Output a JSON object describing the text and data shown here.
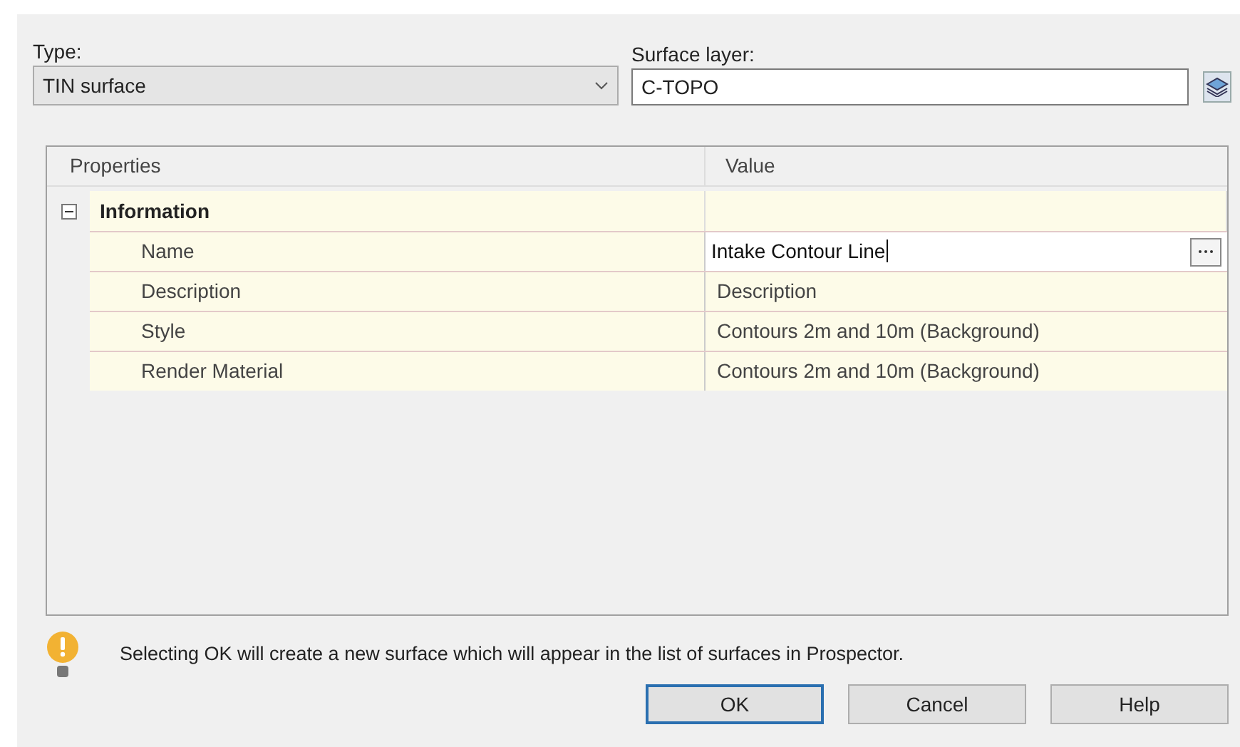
{
  "type_field": {
    "label": "Type:",
    "value": "TIN surface"
  },
  "surface_layer": {
    "label": "Surface layer:",
    "value": "C-TOPO"
  },
  "properties": {
    "columns": [
      "Properties",
      "Value"
    ],
    "category": {
      "label": "Information",
      "expanded": true,
      "children": [
        {
          "name": "Name",
          "value": "Intake Contour Line",
          "editing": true
        },
        {
          "name": "Description",
          "value": "Description",
          "editing": false
        },
        {
          "name": "Style",
          "value": "Contours 2m and 10m (Background)",
          "editing": false
        },
        {
          "name": "Render Material",
          "value": "Contours 2m and 10m (Background)",
          "editing": false
        }
      ]
    }
  },
  "message": "Selecting OK will create a new surface which will appear in the list of surfaces in Prospector.",
  "buttons": [
    {
      "label": "OK",
      "selected": true
    },
    {
      "label": "Cancel",
      "selected": false
    },
    {
      "label": "Help",
      "selected": false
    }
  ]
}
